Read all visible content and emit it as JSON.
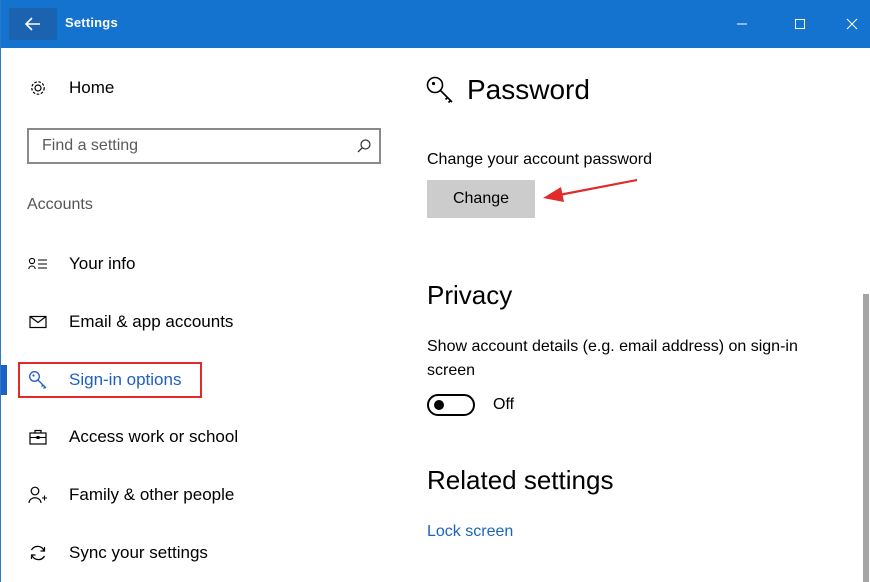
{
  "window": {
    "title": "Settings"
  },
  "sidebar": {
    "home_label": "Home",
    "search_placeholder": "Find a setting",
    "section_label": "Accounts",
    "items": [
      {
        "label": "Your info",
        "icon": "contact-info-icon"
      },
      {
        "label": "Email & app accounts",
        "icon": "mail-icon"
      },
      {
        "label": "Sign-in options",
        "icon": "key-icon",
        "active": true
      },
      {
        "label": "Access work or school",
        "icon": "briefcase-icon"
      },
      {
        "label": "Family & other people",
        "icon": "person-add-icon"
      },
      {
        "label": "Sync your settings",
        "icon": "sync-icon"
      }
    ]
  },
  "main": {
    "password": {
      "title": "Password",
      "description": "Change your account password",
      "button_label": "Change"
    },
    "privacy": {
      "title": "Privacy",
      "description": "Show account details (e.g. email address) on sign-in screen",
      "toggle_state": "Off"
    },
    "related": {
      "title": "Related settings",
      "link_label": "Lock screen"
    }
  },
  "colors": {
    "titlebar": "#1373cf",
    "accent": "#1f5fbf",
    "highlight": "#e22a2a",
    "button": "#cccccc"
  }
}
